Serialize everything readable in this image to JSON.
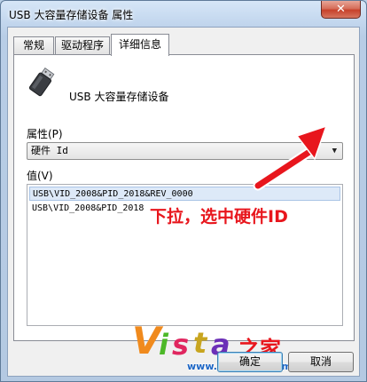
{
  "window": {
    "title": "USB 大容量存储设备 属性",
    "close_glyph": "✕"
  },
  "tabs": [
    {
      "label": "常规",
      "active": false
    },
    {
      "label": "驱动程序",
      "active": false
    },
    {
      "label": "详细信息",
      "active": true
    }
  ],
  "details": {
    "device_name": "USB 大容量存储设备",
    "property_label": "属性(P)",
    "property_selected": "硬件 Id",
    "value_label": "值(V)",
    "values": [
      "USB\\VID_2008&PID_2018&REV_0000",
      "USB\\VID_2008&PID_2018"
    ],
    "selected_value_index": 0
  },
  "annotation": {
    "text": "下拉，选中硬件ID",
    "color": "#e8161d"
  },
  "buttons": {
    "ok_label": "确定",
    "cancel_label": "取消"
  },
  "watermark": {
    "letters": [
      "V",
      "i",
      "s",
      "t",
      "a"
    ],
    "suffix": "之家",
    "url": "www.Vista123.com"
  },
  "icons": {
    "device": "usb-drive-icon",
    "dropdown": "chevron-down-icon",
    "close": "close-icon"
  }
}
